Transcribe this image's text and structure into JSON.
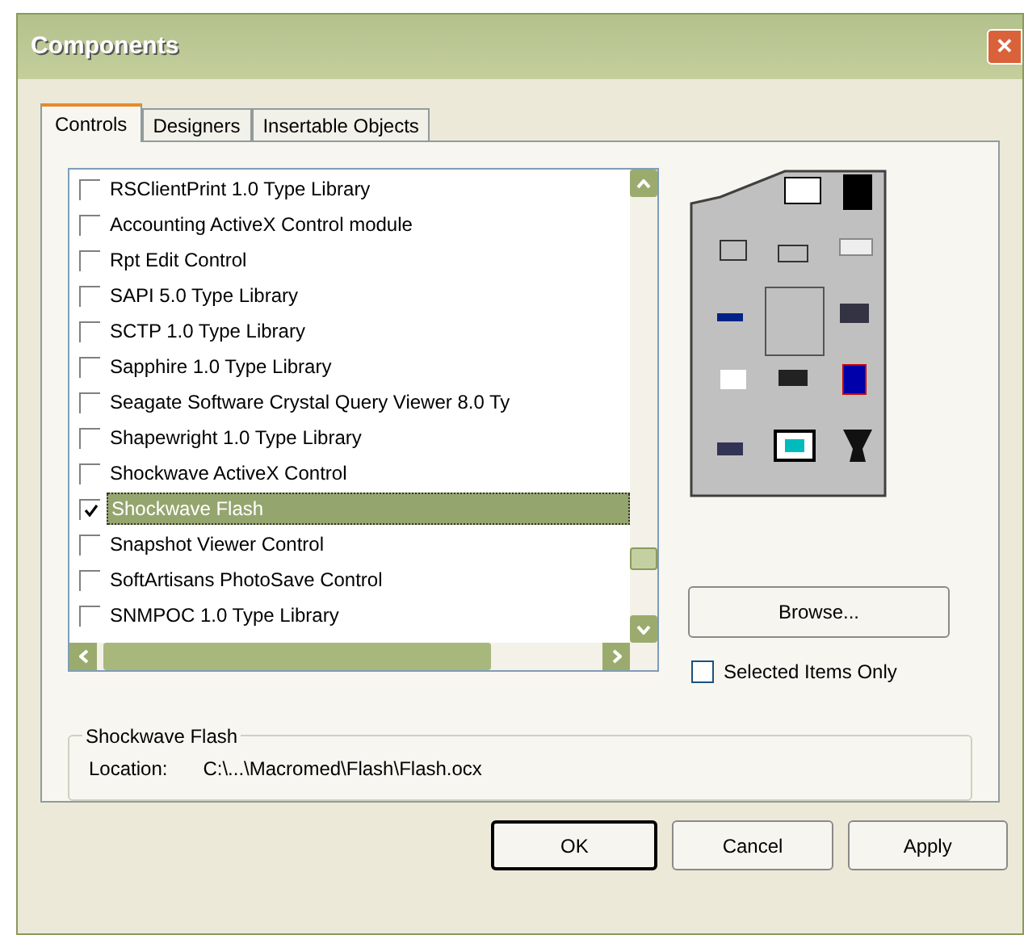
{
  "window": {
    "title": "Components",
    "close": "✕"
  },
  "tabs": [
    {
      "label": "Controls",
      "selected": true
    },
    {
      "label": "Designers",
      "selected": false
    },
    {
      "label": "Insertable Objects",
      "selected": false
    }
  ],
  "list": {
    "items": [
      {
        "label": "RSClientPrint 1.0 Type Library",
        "checked": false,
        "selected": false
      },
      {
        "label": "Accounting ActiveX Control module",
        "checked": false,
        "selected": false
      },
      {
        "label": "Rpt Edit Control",
        "checked": false,
        "selected": false
      },
      {
        "label": "SAPI 5.0 Type Library",
        "checked": false,
        "selected": false
      },
      {
        "label": "SCTP 1.0 Type Library",
        "checked": false,
        "selected": false
      },
      {
        "label": "Sapphire 1.0 Type Library",
        "checked": false,
        "selected": false
      },
      {
        "label": "Seagate Software Crystal Query Viewer 8.0 Ty",
        "checked": false,
        "selected": false
      },
      {
        "label": "Shapewright 1.0 Type Library",
        "checked": false,
        "selected": false
      },
      {
        "label": "Shockwave ActiveX Control",
        "checked": false,
        "selected": false
      },
      {
        "label": "Shockwave Flash",
        "checked": true,
        "selected": true
      },
      {
        "label": "Snapshot Viewer Control",
        "checked": false,
        "selected": false
      },
      {
        "label": "SoftArtisans PhotoSave Control",
        "checked": false,
        "selected": false
      },
      {
        "label": "SNMPOC 1.0 Type Library",
        "checked": false,
        "selected": false
      }
    ]
  },
  "browse_button": "Browse...",
  "selected_only": {
    "label": "Selected Items Only",
    "checked": false
  },
  "details": {
    "title": "Shockwave Flash",
    "location_label": "Location:",
    "location": "C:\\...\\Macromed\\Flash\\Flash.ocx"
  },
  "buttons": [
    {
      "label": "OK",
      "default": true
    },
    {
      "label": "Cancel",
      "default": false
    },
    {
      "label": "Apply",
      "default": false
    }
  ]
}
